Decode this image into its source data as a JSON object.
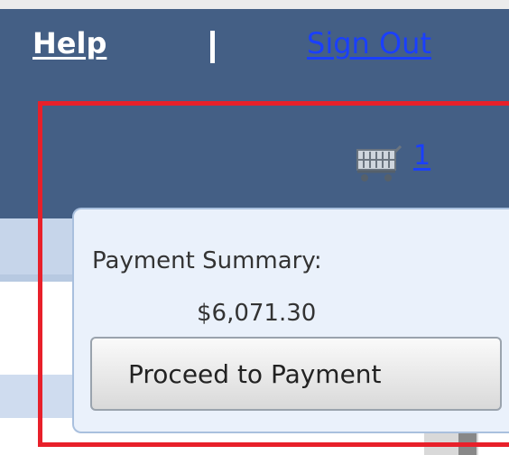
{
  "nav": {
    "help_label": "Help",
    "divider": "|",
    "signout_label": "Sign Out"
  },
  "cart": {
    "icon": "shopping-cart-icon",
    "count": "1"
  },
  "payment_popup": {
    "summary_label": "Payment Summary:",
    "amount": "$6,071.30",
    "proceed_button_label": "Proceed to Payment"
  },
  "colors": {
    "header_bg": "#445f85",
    "link": "#1a3fff",
    "popup_bg": "#eaf1fb",
    "highlight_border": "#e8202a"
  }
}
